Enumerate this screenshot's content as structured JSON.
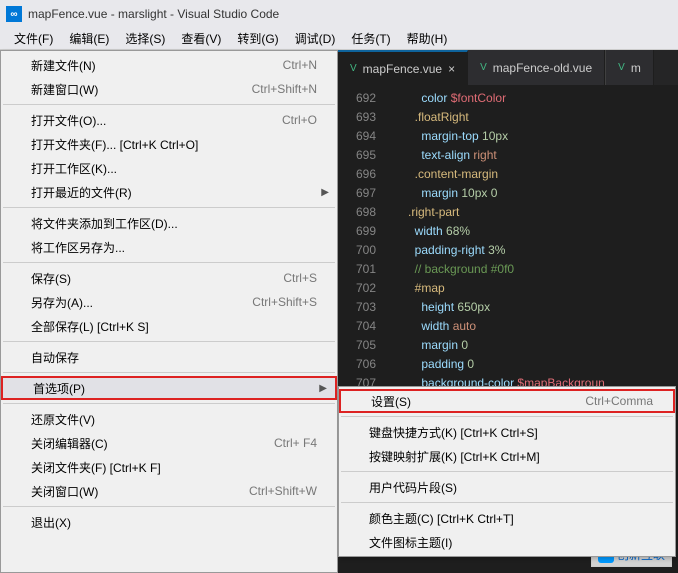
{
  "title": "mapFence.vue - marslight - Visual Studio Code",
  "menubar": [
    "文件(F)",
    "编辑(E)",
    "选择(S)",
    "查看(V)",
    "转到(G)",
    "调试(D)",
    "任务(T)",
    "帮助(H)"
  ],
  "file_menu": [
    {
      "label": "新建文件(N)",
      "shortcut": "Ctrl+N"
    },
    {
      "label": "新建窗口(W)",
      "shortcut": "Ctrl+Shift+N"
    },
    {
      "sep": true
    },
    {
      "label": "打开文件(O)...",
      "shortcut": "Ctrl+O"
    },
    {
      "label": "打开文件夹(F)... [Ctrl+K Ctrl+O]"
    },
    {
      "label": "打开工作区(K)..."
    },
    {
      "label": "打开最近的文件(R)",
      "arrow": true
    },
    {
      "sep": true
    },
    {
      "label": "将文件夹添加到工作区(D)..."
    },
    {
      "label": "将工作区另存为..."
    },
    {
      "sep": true
    },
    {
      "label": "保存(S)",
      "shortcut": "Ctrl+S"
    },
    {
      "label": "另存为(A)...",
      "shortcut": "Ctrl+Shift+S"
    },
    {
      "label": "全部保存(L) [Ctrl+K S]"
    },
    {
      "sep": true
    },
    {
      "label": "自动保存"
    },
    {
      "sep": true
    },
    {
      "label": "首选项(P)",
      "arrow": true,
      "highlighted": true
    },
    {
      "sep": true
    },
    {
      "label": "还原文件(V)"
    },
    {
      "label": "关闭编辑器(C)",
      "shortcut": "Ctrl+ F4"
    },
    {
      "label": "关闭文件夹(F) [Ctrl+K F]"
    },
    {
      "label": "关闭窗口(W)",
      "shortcut": "Ctrl+Shift+W"
    },
    {
      "sep": true
    },
    {
      "label": "退出(X)"
    }
  ],
  "submenu": [
    {
      "label": "设置(S)",
      "shortcut": "Ctrl+Comma",
      "boxed": true
    },
    {
      "sep": true
    },
    {
      "label": "键盘快捷方式(K) [Ctrl+K Ctrl+S]"
    },
    {
      "label": "按键映射扩展(K) [Ctrl+K Ctrl+M]"
    },
    {
      "sep": true
    },
    {
      "label": "用户代码片段(S)"
    },
    {
      "sep": true
    },
    {
      "label": "颜色主题(C) [Ctrl+K Ctrl+T]"
    },
    {
      "label": "文件图标主题(I)"
    }
  ],
  "tabs": [
    {
      "name": "mapFence.vue",
      "active": true
    },
    {
      "name": "mapFence-old.vue"
    },
    {
      "name": "m"
    }
  ],
  "code_lines": [
    {
      "n": 692,
      "indent": 5,
      "tokens": [
        [
          "prop",
          "color"
        ],
        [
          "plain",
          " "
        ],
        [
          "var",
          "$fontColor"
        ]
      ]
    },
    {
      "n": 693,
      "indent": 4,
      "tokens": [
        [
          "sel",
          ".floatRight"
        ]
      ]
    },
    {
      "n": 694,
      "indent": 5,
      "tokens": [
        [
          "prop",
          "margin-top"
        ],
        [
          "plain",
          " "
        ],
        [
          "num",
          "10px"
        ]
      ]
    },
    {
      "n": 695,
      "indent": 5,
      "tokens": [
        [
          "prop",
          "text-align"
        ],
        [
          "plain",
          " "
        ],
        [
          "val",
          "right"
        ]
      ]
    },
    {
      "n": 696,
      "indent": 4,
      "tokens": [
        [
          "sel",
          ".content-margin"
        ]
      ]
    },
    {
      "n": 697,
      "indent": 5,
      "tokens": [
        [
          "prop",
          "margin"
        ],
        [
          "plain",
          " "
        ],
        [
          "num",
          "10px 0"
        ]
      ]
    },
    {
      "n": 698,
      "indent": 3,
      "tokens": [
        [
          "sel",
          ".right-part"
        ]
      ]
    },
    {
      "n": 699,
      "indent": 4,
      "tokens": [
        [
          "prop",
          "width"
        ],
        [
          "plain",
          " "
        ],
        [
          "num",
          "68%"
        ]
      ]
    },
    {
      "n": 700,
      "indent": 4,
      "tokens": [
        [
          "prop",
          "padding-right"
        ],
        [
          "plain",
          " "
        ],
        [
          "num",
          "3%"
        ]
      ]
    },
    {
      "n": 701,
      "indent": 4,
      "tokens": [
        [
          "cmt",
          "// background #0f0"
        ]
      ]
    },
    {
      "n": 702,
      "indent": 4,
      "tokens": [
        [
          "sel",
          "#map"
        ]
      ]
    },
    {
      "n": 703,
      "indent": 5,
      "tokens": [
        [
          "prop",
          "height"
        ],
        [
          "plain",
          " "
        ],
        [
          "num",
          "650px"
        ]
      ]
    },
    {
      "n": 704,
      "indent": 5,
      "tokens": [
        [
          "prop",
          "width"
        ],
        [
          "plain",
          " "
        ],
        [
          "val",
          "auto"
        ]
      ]
    },
    {
      "n": 705,
      "indent": 5,
      "tokens": [
        [
          "prop",
          "margin"
        ],
        [
          "plain",
          " "
        ],
        [
          "num",
          "0"
        ]
      ]
    },
    {
      "n": 706,
      "indent": 5,
      "tokens": [
        [
          "prop",
          "padding"
        ],
        [
          "plain",
          " "
        ],
        [
          "num",
          "0"
        ]
      ]
    },
    {
      "n": 707,
      "indent": 5,
      "tokens": [
        [
          "prop",
          "background-color"
        ],
        [
          "plain",
          " "
        ],
        [
          "var",
          "$mapBackgroun"
        ]
      ]
    }
  ],
  "watermark": "创新互联"
}
